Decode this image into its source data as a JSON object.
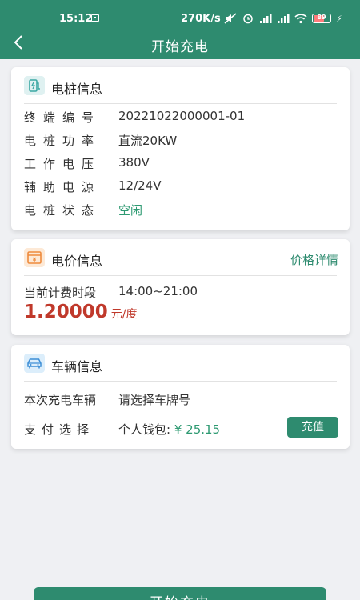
{
  "status_bar": {
    "time": "15:12",
    "network_speed": "270K/s",
    "battery": "89"
  },
  "header": {
    "title": "开始充电"
  },
  "pile_info": {
    "title": "电桩信息",
    "rows": [
      {
        "label": "终端编号",
        "value": "20221022000001-01"
      },
      {
        "label": "电桩功率",
        "value": "直流20KW"
      },
      {
        "label": "工作电压",
        "value": "380V"
      },
      {
        "label": "辅助电源",
        "value": "12/24V"
      },
      {
        "label": "电桩状态",
        "value": "空闲"
      }
    ]
  },
  "price_info": {
    "title": "电价信息",
    "detail_link": "价格详情",
    "period_label": "当前计费时段",
    "period_value": "14:00~21:00",
    "price": "1.20000",
    "unit": "元/度"
  },
  "vehicle_info": {
    "title": "车辆信息",
    "vehicle_label": "本次充电车辆",
    "vehicle_placeholder": "请选择车牌号",
    "payment_label": "支付选择",
    "wallet_label": "个人钱包:",
    "wallet_amount": "¥ 25.15",
    "recharge_label": "充值"
  },
  "footer": {
    "start_label": "开始充电"
  },
  "colors": {
    "primary": "#2e8b6f",
    "price_red": "#c0392b",
    "status_green": "#2e9a72"
  }
}
